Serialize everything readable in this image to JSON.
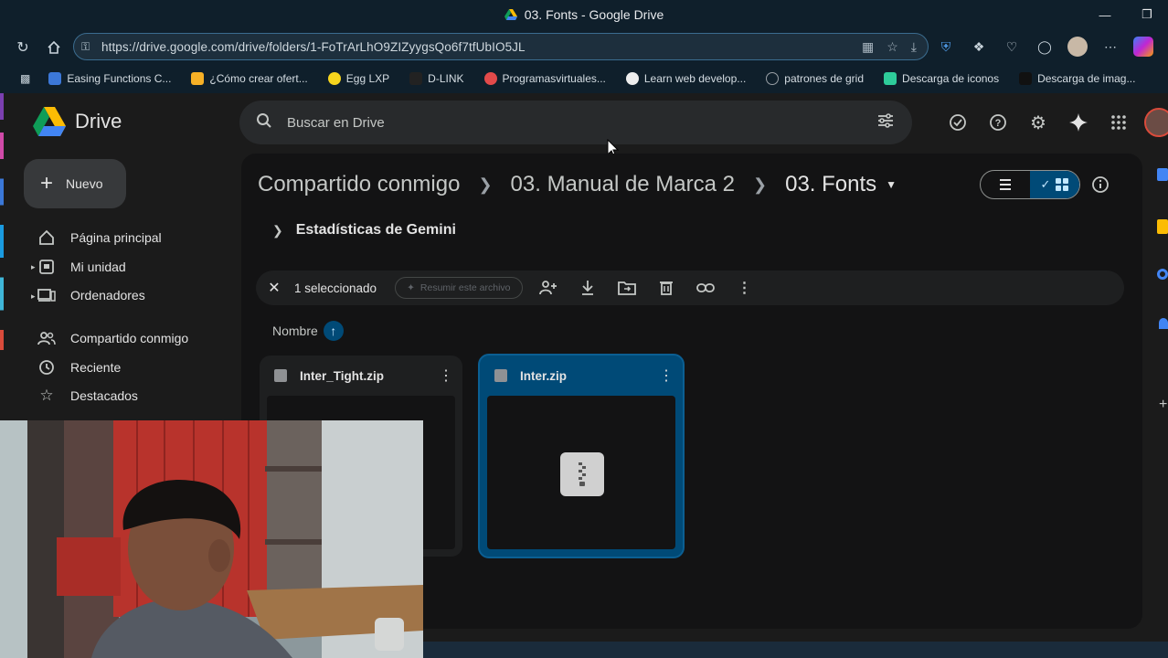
{
  "window": {
    "title": "03. Fonts - Google Drive",
    "controls": [
      "minimize-icon",
      "restore-icon",
      "close-icon"
    ]
  },
  "browser": {
    "url": "https://drive.google.com/drive/folders/1-FoTrArLhO9ZIZyygsQo6f7tfUbIO5JL",
    "bookmarks": [
      {
        "label": "Easing Functions C...",
        "color": "#3c78d8"
      },
      {
        "label": "¿Cómo crear ofert...",
        "color": "#f6b026"
      },
      {
        "label": "Egg LXP",
        "color": "#f7d51d"
      },
      {
        "label": "D-LINK",
        "color": "#222222"
      },
      {
        "label": "Programasvirtuales...",
        "color": "#e34a4a"
      },
      {
        "label": "Learn web develop...",
        "color": "#111111"
      },
      {
        "label": "patrones de grid",
        "color": "#9aa0a6"
      },
      {
        "label": "Descarga de iconos",
        "color": "#2ecc9a"
      },
      {
        "label": "Descarga de imag...",
        "color": "#111111"
      }
    ]
  },
  "drive": {
    "app_name": "Drive",
    "new_button": "Nuevo",
    "search_placeholder": "Buscar en Drive",
    "nav": [
      {
        "label": "Página principal",
        "icon": "home-icon"
      },
      {
        "label": "Mi unidad",
        "icon": "my-drive-icon"
      },
      {
        "label": "Ordenadores",
        "icon": "computers-icon"
      },
      {
        "label": "Compartido conmigo",
        "icon": "shared-icon"
      },
      {
        "label": "Reciente",
        "icon": "clock-icon"
      },
      {
        "label": "Destacados",
        "icon": "star-icon"
      }
    ],
    "breadcrumb": [
      "Compartido conmigo",
      "03. Manual de Marca 2",
      "03. Fonts"
    ],
    "gemini_section": "Estadísticas de Gemini",
    "selection": {
      "count_label": "1 seleccionado",
      "summarize_label": "Resumir este archivo"
    },
    "sort_label": "Nombre",
    "files": [
      {
        "name": "Inter_Tight.zip",
        "selected": false
      },
      {
        "name": "Inter.zip",
        "selected": true
      }
    ]
  }
}
